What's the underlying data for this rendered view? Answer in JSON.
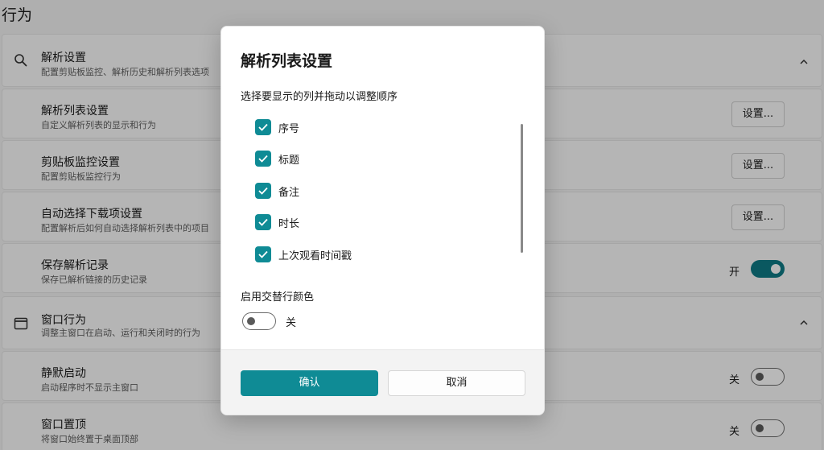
{
  "page": {
    "title": "行为"
  },
  "parse_section": {
    "title": "解析设置",
    "subtitle": "配置剪贴板监控、解析历史和解析列表选项",
    "icon": "search-icon",
    "rows": [
      {
        "title": "解析列表设置",
        "subtitle": "自定义解析列表的显示和行为",
        "button": "设置..."
      },
      {
        "title": "剪贴板监控设置",
        "subtitle": "配置剪贴板监控行为",
        "button": "设置..."
      },
      {
        "title": "自动选择下载项设置",
        "subtitle": "配置解析后如何自动选择解析列表中的项目",
        "button": "设置..."
      },
      {
        "title": "保存解析记录",
        "subtitle": "保存已解析链接的历史记录",
        "toggle_label": "开",
        "toggle_on": true
      }
    ]
  },
  "window_section": {
    "title": "窗口行为",
    "subtitle": "调整主窗口在启动、运行和关闭时的行为",
    "icon": "window-icon",
    "rows": [
      {
        "title": "静默启动",
        "subtitle": "启动程序时不显示主窗口",
        "toggle_label": "关",
        "toggle_on": false
      },
      {
        "title": "窗口置顶",
        "subtitle": "将窗口始终置于桌面顶部",
        "toggle_label": "关",
        "toggle_on": false
      }
    ]
  },
  "dialog": {
    "title": "解析列表设置",
    "description": "选择要显示的列并拖动以调整顺序",
    "columns": [
      {
        "label": "序号",
        "checked": true
      },
      {
        "label": "标题",
        "checked": true
      },
      {
        "label": "备注",
        "checked": true
      },
      {
        "label": "时长",
        "checked": true
      },
      {
        "label": "上次观看时间戳",
        "checked": true
      }
    ],
    "alt_row_label": "启用交替行颜色",
    "alt_row_toggle_label": "关",
    "alt_row_toggle_on": false,
    "confirm_label": "确认",
    "cancel_label": "取消"
  },
  "colors": {
    "accent": "#0f8b95",
    "accent_dark": "#0f7b86"
  }
}
